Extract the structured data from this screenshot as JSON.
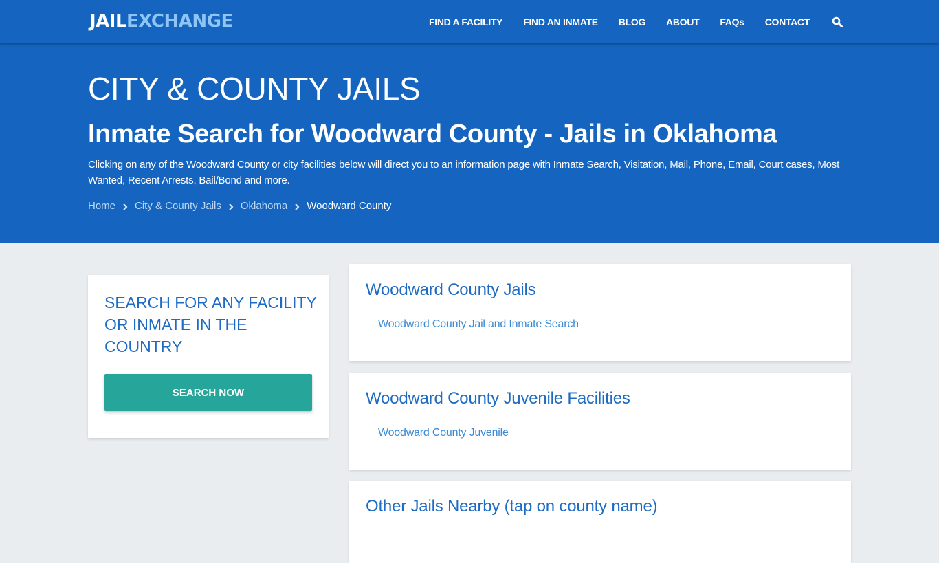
{
  "header": {
    "logo": {
      "part1": "JAIL",
      "part2": "EXCHANGE"
    },
    "nav": [
      {
        "label": "FIND A FACILITY"
      },
      {
        "label": "FIND AN INMATE"
      },
      {
        "label": "BLOG"
      },
      {
        "label": "ABOUT"
      },
      {
        "label": "FAQs"
      },
      {
        "label": "CONTACT"
      }
    ],
    "search_icon": "search-icon"
  },
  "hero": {
    "kicker": "CITY & COUNTY JAILS",
    "title": "Inmate Search for Woodward County - Jails in Oklahoma",
    "description": "Clicking on any of the Woodward County or city facilities below will direct you to an information page with Inmate Search, Visitation, Mail, Phone, Email, Court cases, Most Wanted, Recent Arrests, Bail/Bond and more.",
    "breadcrumb": [
      {
        "label": "Home"
      },
      {
        "label": "City & County Jails"
      },
      {
        "label": "Oklahoma"
      },
      {
        "label": "Woodward County"
      }
    ]
  },
  "sidebar": {
    "title": "SEARCH FOR ANY FACILITY OR INMATE IN THE COUNTRY",
    "button_label": "SEARCH NOW"
  },
  "sections": [
    {
      "title": "Woodward County Jails",
      "links": [
        {
          "label": "Woodward County Jail and Inmate Search"
        }
      ]
    },
    {
      "title": "Woodward County Juvenile Facilities",
      "links": [
        {
          "label": "Woodward County Juvenile"
        }
      ]
    },
    {
      "title": "Other Jails Nearby (tap on county name)",
      "links": []
    }
  ],
  "colors": {
    "brand_blue": "#1565c0",
    "logo_accent": "#8ec5f5",
    "heading_blue": "#1e6bc4",
    "link_blue": "#3a8ad6",
    "button_teal": "#26a69a",
    "page_bg": "#eaedf0"
  }
}
